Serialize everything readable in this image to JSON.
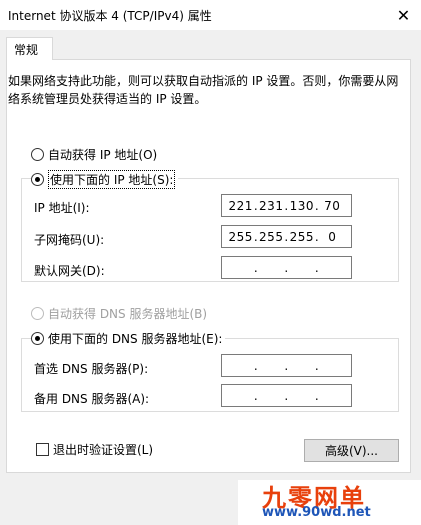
{
  "window": {
    "title": "Internet 协议版本 4 (TCP/IPv4) 属性",
    "close_glyph": "✕"
  },
  "tabs": [
    {
      "label": "常规"
    }
  ],
  "description": "如果网络支持此功能，则可以获取自动指派的 IP 设置。否则，你需要从网络系统管理员处获得适当的 IP 设置。",
  "ip_section": {
    "auto_label": "自动获得 IP 地址(O)",
    "manual_label": "使用下面的 IP 地址(S):",
    "selected": "manual",
    "fields": [
      {
        "label": "IP 地址(I):",
        "octets": [
          "221",
          "231",
          "130",
          "70"
        ]
      },
      {
        "label": "子网掩码(U):",
        "octets": [
          "255",
          "255",
          "255",
          "0"
        ]
      },
      {
        "label": "默认网关(D):",
        "octets": [
          "",
          "",
          "",
          ""
        ]
      }
    ]
  },
  "dns_section": {
    "auto_label": "自动获得 DNS 服务器地址(B)",
    "manual_label": "使用下面的 DNS 服务器地址(E):",
    "selected": "manual",
    "fields": [
      {
        "label": "首选 DNS 服务器(P):",
        "octets": [
          "",
          "",
          "",
          ""
        ]
      },
      {
        "label": "备用 DNS 服务器(A):",
        "octets": [
          "",
          "",
          "",
          ""
        ]
      }
    ]
  },
  "validate_checkbox": {
    "label": "退出时验证设置(L)",
    "checked": false
  },
  "advanced_button": {
    "label": "高级(V)..."
  },
  "watermark": {
    "logo": "九零网单",
    "url": "www.90wd.net"
  },
  "colors": {
    "watermark_logo": "#e8400c",
    "watermark_url": "#1e56b8",
    "disabled_text": "#a0a0a0"
  }
}
